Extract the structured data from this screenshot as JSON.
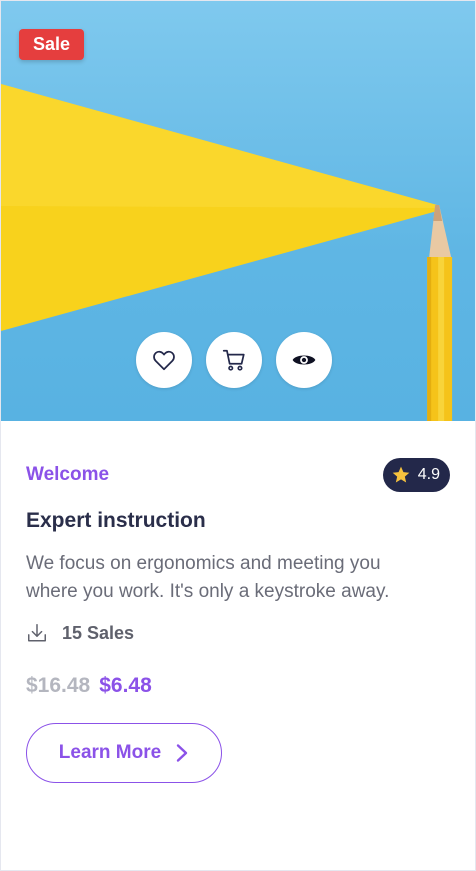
{
  "badge": {
    "label": "Sale",
    "color": "#e53e3e"
  },
  "actions": [
    {
      "icon": "heart-icon"
    },
    {
      "icon": "cart-icon"
    },
    {
      "icon": "eye-icon"
    }
  ],
  "category": "Welcome",
  "rating": {
    "value": "4.9",
    "icon": "star-icon",
    "star_color": "#f6c23e"
  },
  "title": "Expert instruction",
  "description": "We focus on ergonomics and meeting you where you work. It's only a keystroke away.",
  "sales": {
    "text": "15 Sales",
    "icon": "download-icon"
  },
  "price": {
    "old": "$16.48",
    "new": "$6.48"
  },
  "cta": {
    "label": "Learn More",
    "icon": "chevron-right-icon"
  },
  "colors": {
    "accent": "#8b52e8",
    "dark": "#23284a",
    "image_bg": "#6cbfea",
    "pencil": "#f9d11c"
  }
}
